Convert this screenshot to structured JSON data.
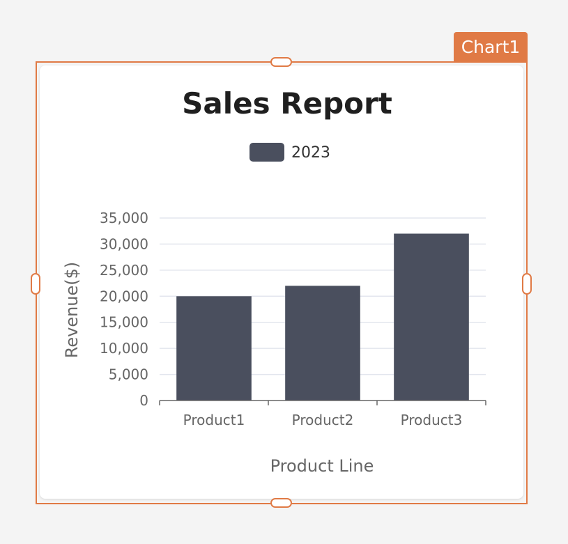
{
  "widget": {
    "tag_label": "Chart1"
  },
  "colors": {
    "accent": "#e07a45",
    "series": "#4a4f5e",
    "grid": "#e3e6ee"
  },
  "chart_data": {
    "type": "bar",
    "title": "Sales Report",
    "categories": [
      "Product1",
      "Product2",
      "Product3"
    ],
    "series": [
      {
        "name": "2023",
        "values": [
          20000,
          22000,
          32000
        ]
      }
    ],
    "xlabel": "Product Line",
    "ylabel": "Revenue($)",
    "ylim": [
      0,
      35000
    ],
    "yticks": [
      {
        "value": 0,
        "label": "0"
      },
      {
        "value": 5000,
        "label": "5,000"
      },
      {
        "value": 10000,
        "label": "10,000"
      },
      {
        "value": 15000,
        "label": "15,000"
      },
      {
        "value": 20000,
        "label": "20,000"
      },
      {
        "value": 25000,
        "label": "25,000"
      },
      {
        "value": 30000,
        "label": "30,000"
      },
      {
        "value": 35000,
        "label": "35,000"
      }
    ],
    "grid": true,
    "legend_position": "top-center"
  }
}
